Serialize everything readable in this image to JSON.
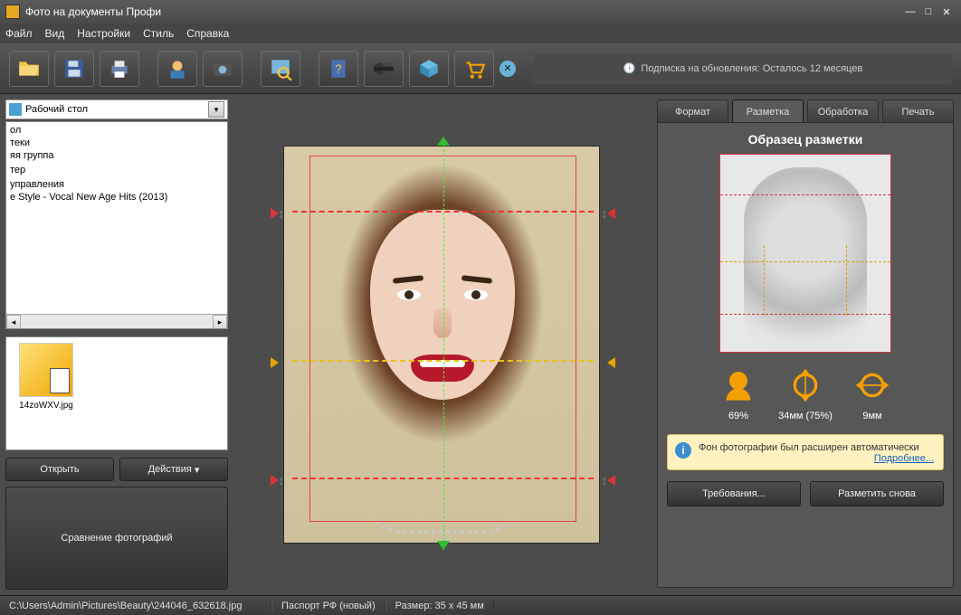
{
  "title": "Фото на документы Профи",
  "menu": {
    "file": "Файл",
    "view": "Вид",
    "settings": "Настройки",
    "style": "Стиль",
    "help": "Справка"
  },
  "subscription": {
    "icon": "clock-icon",
    "text": "Подписка на обновления: Осталось 12 месяцев"
  },
  "sidebar": {
    "location_label": "Рабочий стол",
    "items": [
      "ол",
      "теки",
      "яя группа",
      "",
      "тер",
      "",
      "управления",
      "e Style - Vocal New Age Hits (2013)"
    ],
    "thumbs": [
      {
        "name": "14zoWXV.jpg"
      }
    ],
    "open_btn": "Открыть",
    "actions_btn": "Действия",
    "compare_btn": "Сравнение фотографий"
  },
  "tabs": {
    "format": "Формат",
    "markup": "Разметка",
    "processing": "Обработка",
    "print": "Печать",
    "active": "markup"
  },
  "markup_panel": {
    "title": "Образец разметки",
    "metrics": [
      {
        "icon": "head-ratio-icon",
        "label": "69%"
      },
      {
        "icon": "head-height-icon",
        "label": "34мм (75%)"
      },
      {
        "icon": "head-width-icon",
        "label": "9мм"
      }
    ],
    "info": {
      "text": "Фон фотографии был расширен автоматически",
      "link": "Подробнее..."
    },
    "requirements_btn": "Требования...",
    "remark_btn": "Разметить снова"
  },
  "status": {
    "path": "C:\\Users\\Admin\\Pictures\\Beauty\\244046_632618.jpg",
    "doc_type": "Паспорт РФ (новый)",
    "size": "Размер: 35 x 45 мм"
  },
  "toolbar_icons": [
    "folder-open",
    "save",
    "print",
    "user-photo",
    "camera",
    "search-image",
    "help-book",
    "clapperboard",
    "package",
    "cart"
  ]
}
